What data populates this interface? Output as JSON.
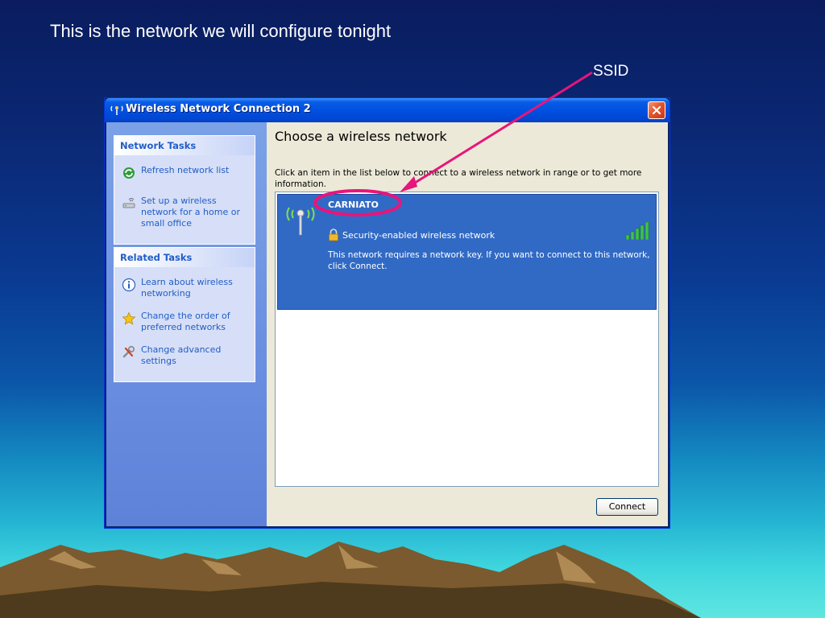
{
  "slide": {
    "title": "This is the network we will configure tonight",
    "callout_label": "SSID"
  },
  "window": {
    "title": "Wireless Network Connection 2",
    "title_icon": "wireless-icon",
    "close_icon": "close-icon"
  },
  "sidebar": {
    "network_tasks": {
      "header": "Network Tasks",
      "items": [
        {
          "label": "Refresh network list",
          "icon": "refresh-icon"
        },
        {
          "label": "Set up a wireless network for a home or small office",
          "icon": "setup-network-icon"
        }
      ]
    },
    "related_tasks": {
      "header": "Related Tasks",
      "items": [
        {
          "label": "Learn about wireless networking",
          "icon": "info-icon"
        },
        {
          "label": "Change the order of preferred networks",
          "icon": "star-icon"
        },
        {
          "label": "Change advanced settings",
          "icon": "tools-icon"
        }
      ]
    }
  },
  "main": {
    "title": "Choose a wireless network",
    "instructions": "Click an item in the list below to connect to a wireless network in range or to get more information.",
    "networks": [
      {
        "ssid": "CARNIATO",
        "security": "Security-enabled wireless network",
        "description": "This network requires a network key. If you want to connect to this network, click Connect.",
        "signal_bars": 5,
        "selected": true
      }
    ],
    "connect_button": "Connect"
  },
  "colors": {
    "titlebar": "#0050e0",
    "sidebar": "#6a8ee0",
    "selection": "#316ac5",
    "link_text": "#215dc6",
    "callout": "#e8157a"
  }
}
